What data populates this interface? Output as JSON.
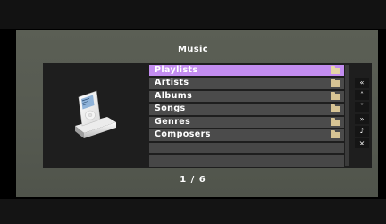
{
  "header": {
    "title": "Music"
  },
  "menu": {
    "items": [
      {
        "label": "Playlists",
        "selected": true
      },
      {
        "label": "Artists",
        "selected": false
      },
      {
        "label": "Albums",
        "selected": false
      },
      {
        "label": "Songs",
        "selected": false
      },
      {
        "label": "Genres",
        "selected": false
      },
      {
        "label": "Composers",
        "selected": false
      }
    ],
    "selected_color": "#c38df0",
    "item_icon": "folder-icon"
  },
  "controls": [
    {
      "name": "page-up-button",
      "glyph": "«",
      "icon": "double-chevron-up-icon"
    },
    {
      "name": "scroll-up-button",
      "glyph": "˄",
      "icon": "chevron-up-icon"
    },
    {
      "name": "scroll-down-button",
      "glyph": "˅",
      "icon": "chevron-down-icon"
    },
    {
      "name": "page-down-button",
      "glyph": "»",
      "icon": "double-chevron-down-icon"
    },
    {
      "name": "music-button",
      "glyph": "♪",
      "icon": "music-note-icon"
    },
    {
      "name": "close-button",
      "glyph": "×",
      "icon": "close-icon"
    }
  ],
  "pagination": {
    "text": "1 / 6"
  },
  "device": {
    "icon": "ipod-dock-icon"
  }
}
